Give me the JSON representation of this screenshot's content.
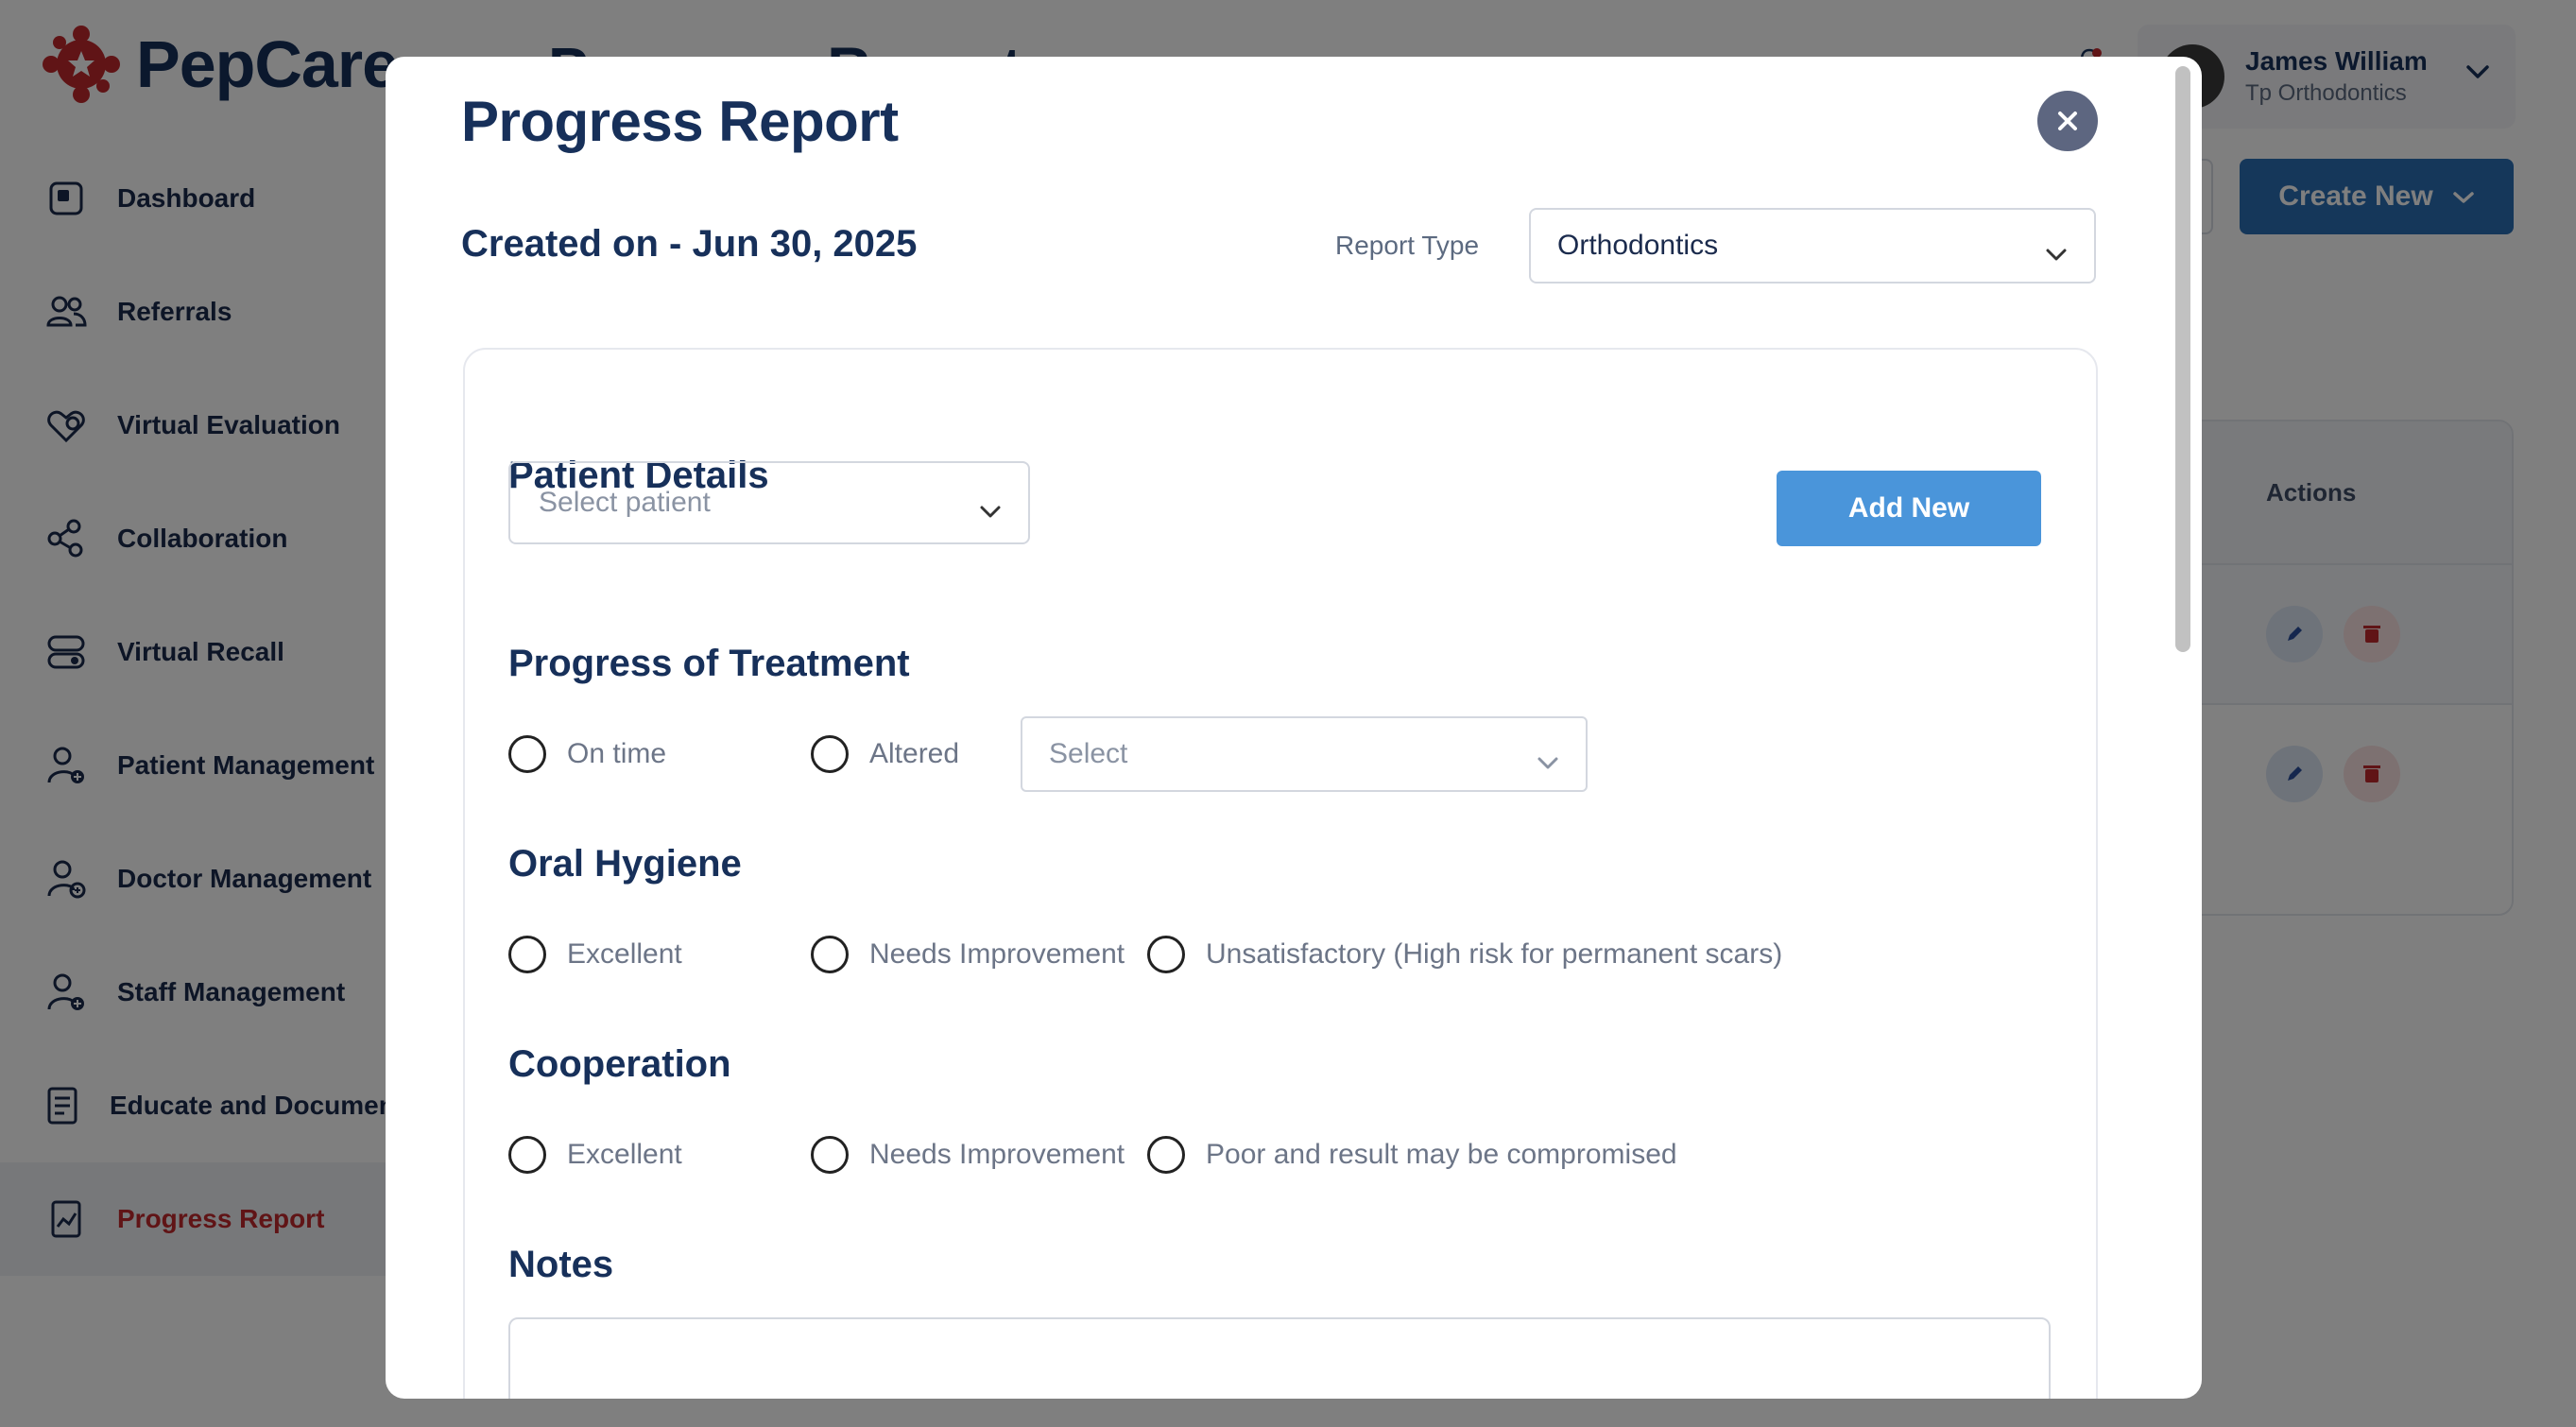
{
  "app": {
    "brand": "PepCare",
    "page_title": "Progress Report"
  },
  "sidebar": {
    "items": [
      {
        "label": "Dashboard",
        "icon": "dashboard-icon"
      },
      {
        "label": "Referrals",
        "icon": "users-icon"
      },
      {
        "label": "Virtual Evaluation",
        "icon": "heart-icon"
      },
      {
        "label": "Collaboration",
        "icon": "collaboration-icon"
      },
      {
        "label": "Virtual Recall",
        "icon": "recall-icon"
      },
      {
        "label": "Patient Management",
        "icon": "patient-icon"
      },
      {
        "label": "Doctor Management",
        "icon": "doctor-icon"
      },
      {
        "label": "Staff Management",
        "icon": "staff-icon"
      },
      {
        "label": "Educate and Document",
        "icon": "document-icon"
      },
      {
        "label": "Progress Report",
        "icon": "report-icon"
      }
    ],
    "active_item": "Progress Report"
  },
  "user": {
    "name": "James William",
    "org": "Tp Orthodontics"
  },
  "toolbar": {
    "create_label": "Create New"
  },
  "table": {
    "actions_header": "Actions"
  },
  "modal": {
    "title": "Progress Report",
    "created_on": "Created on - Jun 30, 2025",
    "report_type_label": "Report Type",
    "report_type_value": "Orthodontics",
    "patient_details": {
      "title": "Patient Details",
      "placeholder": "Select patient",
      "add_new_label": "Add New"
    },
    "progress_of_treatment": {
      "title": "Progress of Treatment",
      "options": [
        "On time",
        "Altered"
      ],
      "select_placeholder": "Select"
    },
    "oral_hygiene": {
      "title": "Oral Hygiene",
      "options": [
        "Excellent",
        "Needs Improvement",
        "Unsatisfactory (High risk for permanent scars)"
      ]
    },
    "cooperation": {
      "title": "Cooperation",
      "options": [
        "Excellent",
        "Needs Improvement",
        "Poor and result may be compromised"
      ]
    },
    "notes": {
      "title": "Notes"
    }
  },
  "colors": {
    "brand_navy": "#17305a",
    "brand_red": "#c0292d",
    "primary_button": "#4a95da",
    "create_button": "#2a6eb5"
  }
}
